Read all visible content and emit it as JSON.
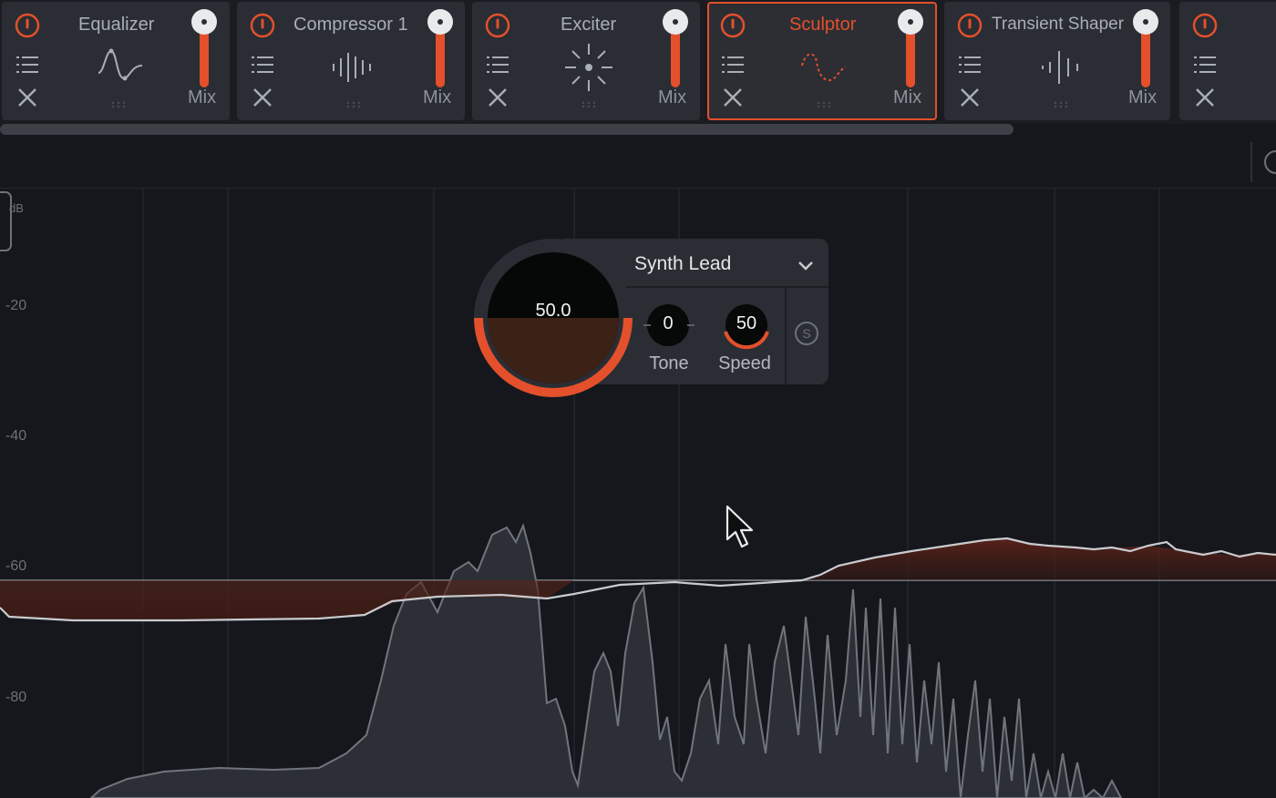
{
  "colors": {
    "accent": "#e3502b",
    "module_bg": "#2a2d33",
    "background": "#15171c"
  },
  "rack": {
    "modules": [
      {
        "name": "Equalizer",
        "mix_label": "Mix",
        "icon": "eq-curve-icon",
        "selected": false
      },
      {
        "name": "Compressor 1",
        "mix_label": "Mix",
        "icon": "compressor-waveform-icon",
        "selected": false
      },
      {
        "name": "Exciter",
        "mix_label": "Mix",
        "icon": "exciter-sparkle-icon",
        "selected": false
      },
      {
        "name": "Sculptor",
        "mix_label": "Mix",
        "icon": "sculptor-curve-icon",
        "selected": true
      },
      {
        "name": "Transient Shaper",
        "mix_label": "Mix",
        "icon": "transient-waveform-icon",
        "selected": false
      }
    ]
  },
  "graph": {
    "unit_label": "dB",
    "y_labels": [
      "-20",
      "-40",
      "-60",
      "-80"
    ]
  },
  "sculptor_panel": {
    "amount": "50.0",
    "amount_fraction": 0.5,
    "preset": "Synth Lead",
    "tone": {
      "value": "0",
      "label": "Tone"
    },
    "speed": {
      "value": "50",
      "label": "Speed"
    },
    "solo_icon": "s-circle-icon"
  }
}
